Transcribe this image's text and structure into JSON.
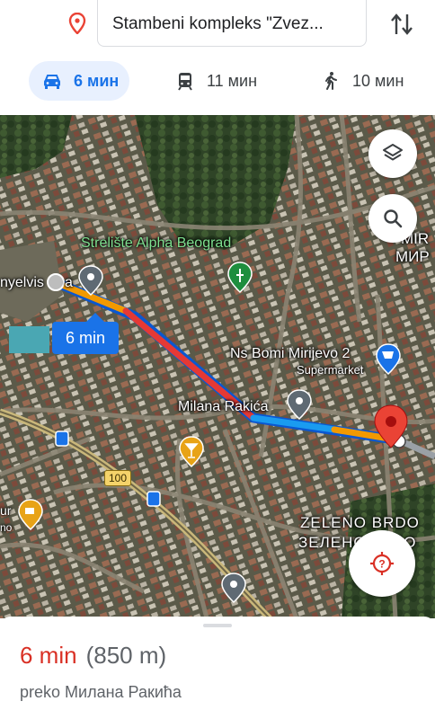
{
  "header": {
    "destination": "Stambeni kompleks \"Zvez...",
    "modes": [
      {
        "name": "driving",
        "label": "6 мин",
        "icon": "car-icon",
        "selected": true
      },
      {
        "name": "transit",
        "label": "11 мин",
        "icon": "train-icon",
        "selected": false
      },
      {
        "name": "walking",
        "label": "10 мин",
        "icon": "walk-icon",
        "selected": false
      }
    ]
  },
  "map": {
    "labels": {
      "place1": "Strelište Alpha Beograd",
      "place2": "Ns Bomi Mirijevo 2",
      "place2_sub": "Supermarket",
      "street": "Milana Rakića",
      "origin_partial": "nyelvis",
      "origin_partial2": "a",
      "area1": "ZELENO BRDO",
      "area2": "ЗЕЛЕНО БРДО",
      "mir_lat": "MIR",
      "mir_cyr": "МИР",
      "left_partial1": "ur",
      "left_partial2": "no",
      "road_number": "100"
    },
    "route_duration": "6 min",
    "colors": {
      "traffic_slow": "#f29900",
      "traffic_heavy": "#e53935",
      "route_clear": "#1a73e8",
      "dest_pin": "#ea4335"
    }
  },
  "sheet": {
    "time": "6 min",
    "distance": "(850 m)",
    "via": "preko Милана Ракића"
  }
}
